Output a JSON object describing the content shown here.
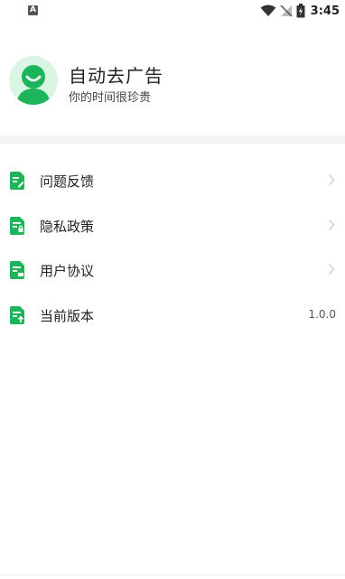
{
  "status_bar": {
    "left_icon_letter": "A",
    "time": "3:45",
    "icons": [
      "wifi-icon",
      "no-signal-icon",
      "battery-charging-icon"
    ]
  },
  "profile": {
    "title": "自动去广告",
    "subtitle": "你的时间很珍贵",
    "avatar_icon": "smiley-avatar-icon"
  },
  "menu": {
    "items": [
      {
        "label": "问题反馈",
        "icon": "feedback-doc-icon",
        "has_chevron": true
      },
      {
        "label": "隐私政策",
        "icon": "privacy-doc-icon",
        "has_chevron": true
      },
      {
        "label": "用户协议",
        "icon": "agreement-doc-icon",
        "has_chevron": true
      },
      {
        "label": "当前版本",
        "icon": "version-doc-icon",
        "value": "1.0.0",
        "has_chevron": false
      }
    ]
  },
  "colors": {
    "accent_green": "#1db45a",
    "avatar_bg": "#d9f5e4",
    "divider_band": "#f4f5f4"
  }
}
